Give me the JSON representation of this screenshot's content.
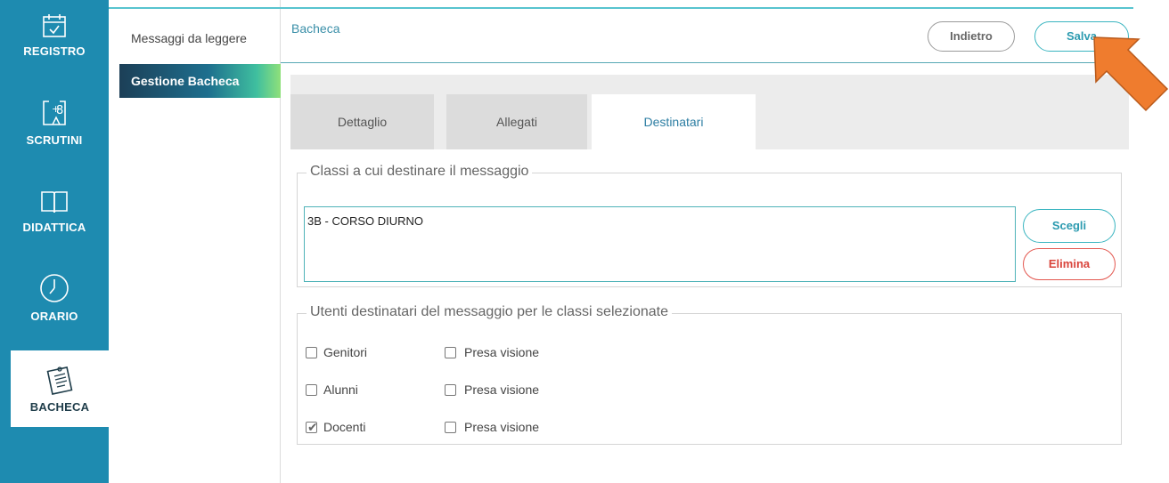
{
  "rail": {
    "items": [
      {
        "label": "REGISTRO",
        "icon": "calendar-icon"
      },
      {
        "label": "SCRUTINI",
        "icon": "plus-eight-icon"
      },
      {
        "label": "DIDATTICA",
        "icon": "book-icon"
      },
      {
        "label": "ORARIO",
        "icon": "clock-icon"
      },
      {
        "label": "BACHECA",
        "icon": "notice-board-icon"
      }
    ],
    "active": "BACHECA"
  },
  "submenu": {
    "items": [
      "Messaggi da leggere",
      "Gestione Bacheca"
    ],
    "active": "Gestione Bacheca"
  },
  "header": {
    "title": "Bacheca",
    "back_label": "Indietro",
    "save_label": "Salva"
  },
  "tabs": {
    "items": [
      "Dettaglio",
      "Allegati",
      "Destinatari"
    ],
    "active": "Destinatari"
  },
  "classes_section": {
    "legend": "Classi a cui destinare il messaggio",
    "selected_classes": "3B - CORSO DIURNO",
    "choose_label": "Scegli",
    "delete_label": "Elimina"
  },
  "users_section": {
    "legend": "Utenti destinatari del messaggio per le classi selezionate",
    "rows": [
      {
        "label": "Genitori",
        "checked": false,
        "ack_label": "Presa visione",
        "ack_checked": false
      },
      {
        "label": "Alunni",
        "checked": false,
        "ack_label": "Presa visione",
        "ack_checked": false
      },
      {
        "label": "Docenti",
        "checked": true,
        "ack_label": "Presa visione",
        "ack_checked": false
      }
    ]
  },
  "colors": {
    "rail": "#1e8bb0",
    "accent": "#3ab5c0",
    "danger": "#e3574f",
    "arrow": "#ef7c2e"
  }
}
